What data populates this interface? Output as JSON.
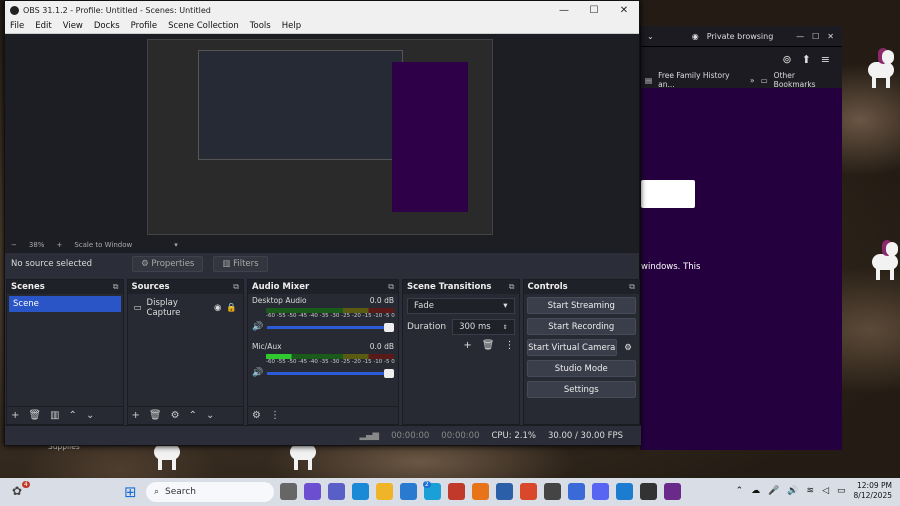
{
  "obs": {
    "window_title": "OBS 31.1.2 - Profile: Untitled - Scenes: Untitled",
    "menu": [
      "File",
      "Edit",
      "View",
      "Docks",
      "Profile",
      "Scene Collection",
      "Tools",
      "Help"
    ],
    "zoom": {
      "level": "38%",
      "scale_mode": "Scale to Window"
    },
    "toolbar": {
      "status": "No source selected",
      "properties": "Properties",
      "filters": "Filters"
    },
    "scenes": {
      "title": "Scenes",
      "items": [
        "Scene"
      ]
    },
    "sources": {
      "title": "Sources",
      "items": [
        "Display Capture"
      ]
    },
    "audio_mixer": {
      "title": "Audio Mixer",
      "channels": [
        {
          "name": "Desktop Audio",
          "level": "0.0 dB"
        },
        {
          "name": "Mic/Aux",
          "level": "0.0 dB"
        }
      ],
      "scale": "-60 -55 -50 -45 -40 -35 -30 -25 -20 -15 -10 -5 0"
    },
    "transitions": {
      "title": "Scene Transitions",
      "type": "Fade",
      "duration_label": "Duration",
      "duration_value": "300 ms"
    },
    "controls": {
      "title": "Controls",
      "start_streaming": "Start Streaming",
      "start_recording": "Start Recording",
      "start_virtual_camera": "Start Virtual Camera",
      "studio_mode": "Studio Mode",
      "settings": "Settings"
    },
    "status": {
      "stream_time": "00:00:00",
      "record_time": "00:00:00",
      "cpu": "CPU: 2.1%",
      "fps": "30.00 / 30.00 FPS"
    }
  },
  "firefox": {
    "tab": "Private browsing",
    "bookmark_1": "Free Family History an...",
    "other_bookmarks": "Other Bookmarks",
    "page_text": "windows. This"
  },
  "desktop": {
    "label": "Supplies"
  },
  "taskbar": {
    "search_placeholder": "Search",
    "time": "12:09 PM",
    "date": "8/12/2025",
    "badge_count": "4",
    "notification_count": "2"
  },
  "colors": {
    "accent": "#2a55c6",
    "obs_bg": "#2b2e38",
    "firefox_content": "#25003e"
  }
}
